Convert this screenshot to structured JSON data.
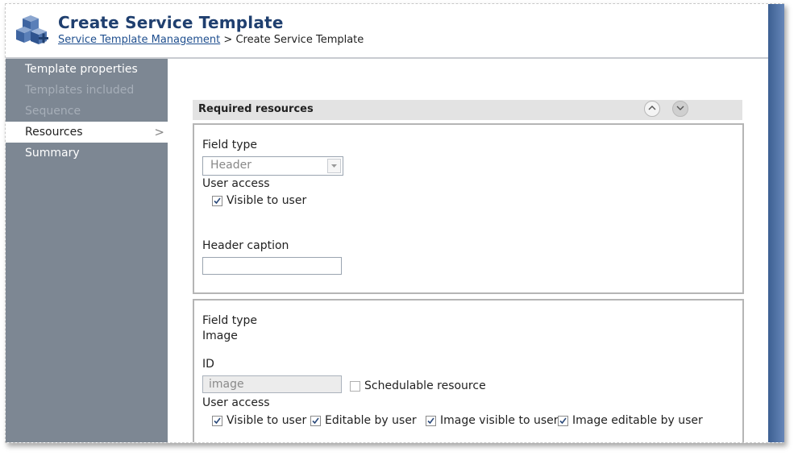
{
  "header": {
    "title": "Create Service Template",
    "breadcrumb_link": "Service Template Management",
    "breadcrumb_separator": ">",
    "breadcrumb_current": "Create Service Template"
  },
  "sidebar": {
    "items": [
      {
        "label": "Template properties",
        "state": "enabled"
      },
      {
        "label": "Templates included",
        "state": "disabled"
      },
      {
        "label": "Sequence",
        "state": "disabled"
      },
      {
        "label": "Resources",
        "state": "active"
      },
      {
        "label": "Summary",
        "state": "enabled"
      }
    ],
    "active_chevron": ">"
  },
  "section": {
    "title": "Required resources"
  },
  "panel1": {
    "field_type_label": "Field type",
    "field_type_value": "Header",
    "user_access_label": "User access",
    "visible_to_user": "Visible to user",
    "header_caption_label": "Header caption",
    "header_caption_value": ""
  },
  "panel2": {
    "field_type_label": "Field type",
    "field_type_value": "Image",
    "id_label": "ID",
    "id_value": "image",
    "schedulable_resource": "Schedulable resource",
    "user_access_label": "User access",
    "visible_to_user": "Visible to user",
    "editable_by_user": "Editable by user",
    "image_visible_to_user": "Image visible to user",
    "image_editable_by_user": "Image editable by user"
  },
  "colors": {
    "title": "#1f3f6f",
    "sidebar_bg": "#7d8793",
    "section_bar": "#e3e3e3",
    "right_strip": "#4a6a9c"
  }
}
